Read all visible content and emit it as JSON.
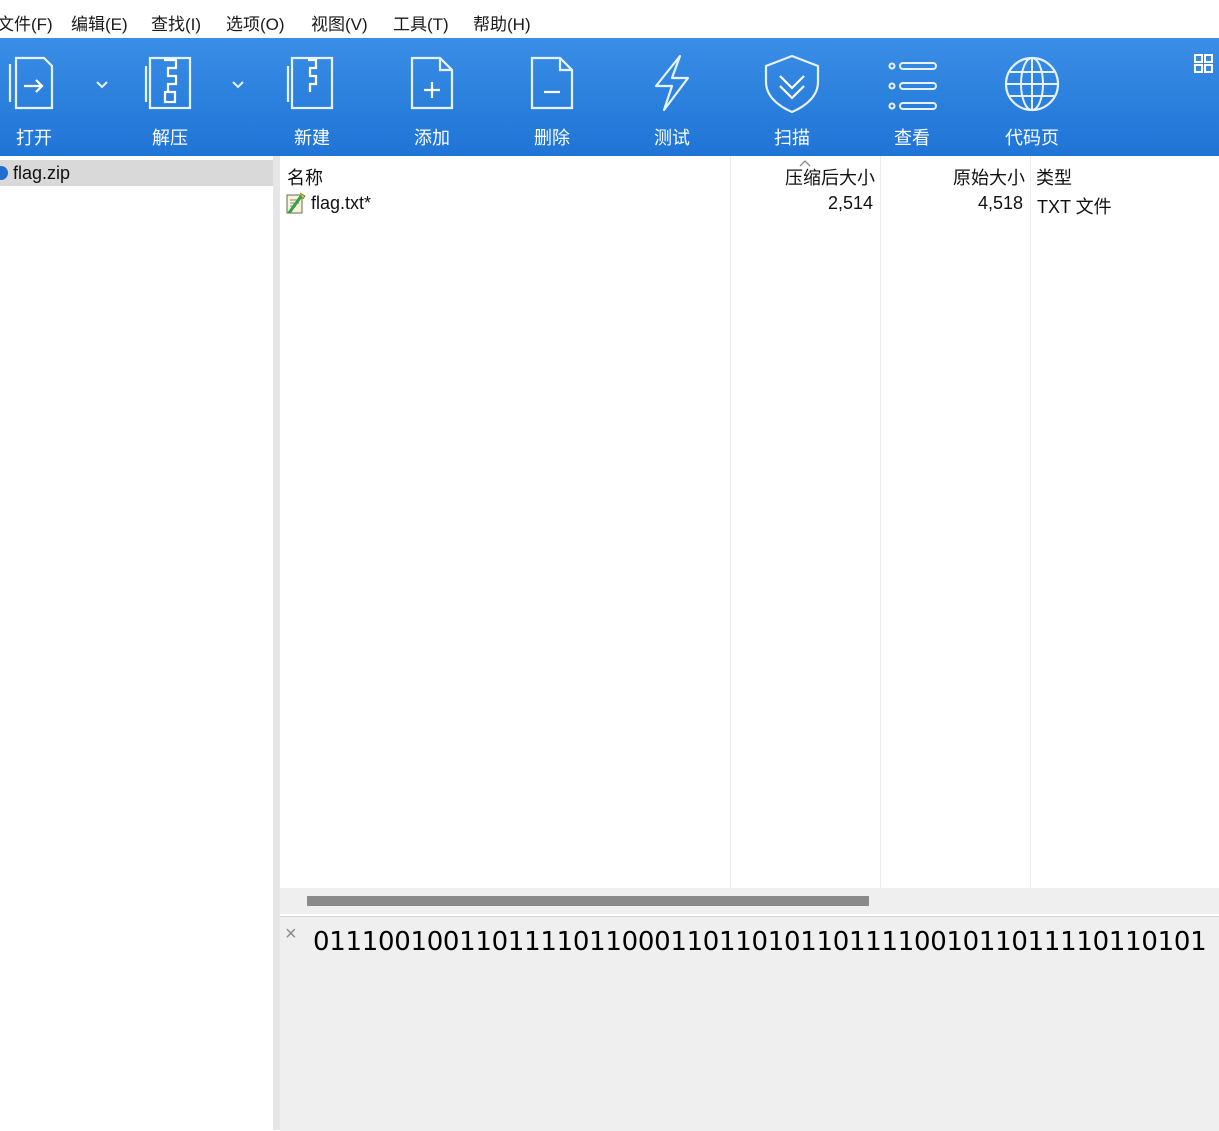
{
  "menu": [
    "文件(F)",
    "编辑(E)",
    "查找(I)",
    "选项(O)",
    "视图(V)",
    "工具(T)",
    "帮助(H)"
  ],
  "toolbar": [
    {
      "label": "打开",
      "icon": "open-icon"
    },
    {
      "label": "解压",
      "icon": "extract-icon"
    },
    {
      "label": "新建",
      "icon": "new-archive-icon"
    },
    {
      "label": "添加",
      "icon": "add-icon"
    },
    {
      "label": "删除",
      "icon": "delete-icon"
    },
    {
      "label": "测试",
      "icon": "test-icon"
    },
    {
      "label": "扫描",
      "icon": "scan-shield-icon"
    },
    {
      "label": "查看",
      "icon": "view-list-icon"
    },
    {
      "label": "代码页",
      "icon": "globe-icon"
    }
  ],
  "tree": {
    "archive": "flag.zip"
  },
  "columns": {
    "name": "名称",
    "packed": "压缩后大小",
    "size": "原始大小",
    "type": "类型"
  },
  "files": [
    {
      "name": "flag.txt*",
      "packed": "2,514",
      "size": "4,518",
      "type": "TXT 文件"
    }
  ],
  "comment": {
    "close": "×",
    "text": "0111001001101111011000110110101101111001011011110110101"
  },
  "colors": {
    "toolbar_top": "#3a8ee6",
    "toolbar_bottom": "#1f74d6",
    "selection": "#d9d9d9"
  }
}
